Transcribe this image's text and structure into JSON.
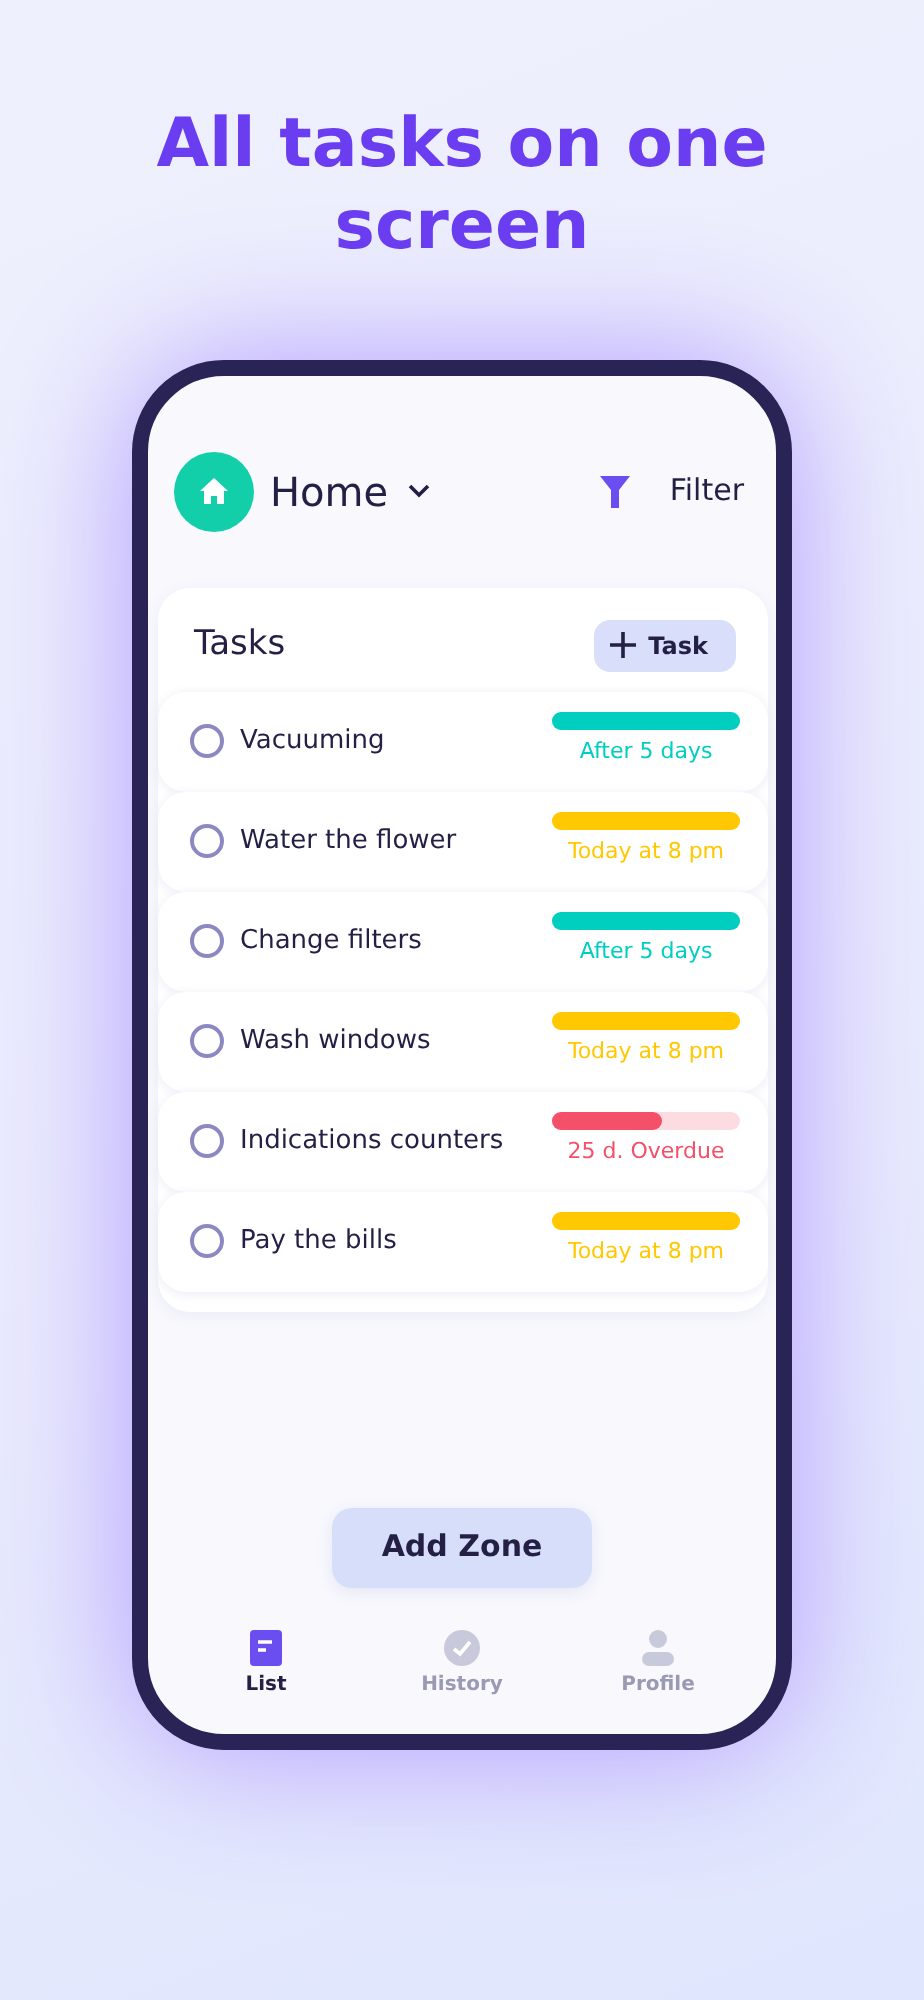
{
  "headline": "All tasks on one screen",
  "header": {
    "zone": "Home",
    "filter": "Filter"
  },
  "card": {
    "title": "Tasks",
    "add_button": "Task"
  },
  "tasks": [
    {
      "name": "Vacuuming",
      "checked": false,
      "level": 1,
      "color": "#00cfc0",
      "due": "After 5 days"
    },
    {
      "name": "Water the flower",
      "checked": false,
      "level": 1,
      "color": "#ffc800",
      "due": "Today at 8 pm"
    },
    {
      "name": "Change filters",
      "checked": false,
      "level": 1,
      "color": "#00cfc0",
      "due": "After 5 days"
    },
    {
      "name": "Wash windows",
      "checked": false,
      "level": 1,
      "color": "#ffc800",
      "due": "Today at 8 pm"
    },
    {
      "name": "Indications counters",
      "checked": false,
      "level": 0.58,
      "color": "#f5506a",
      "due": "25 d. Overdue"
    },
    {
      "name": "Pay the bills",
      "checked": false,
      "level": 1,
      "color": "#ffc800",
      "due": "Today at 8 pm"
    }
  ],
  "add_zone": "Add Zone",
  "nav": [
    {
      "label": "List",
      "kind": "list",
      "selected": true
    },
    {
      "label": "History",
      "kind": "history",
      "selected": false
    },
    {
      "label": "Profile",
      "kind": "profile",
      "selected": false
    }
  ]
}
